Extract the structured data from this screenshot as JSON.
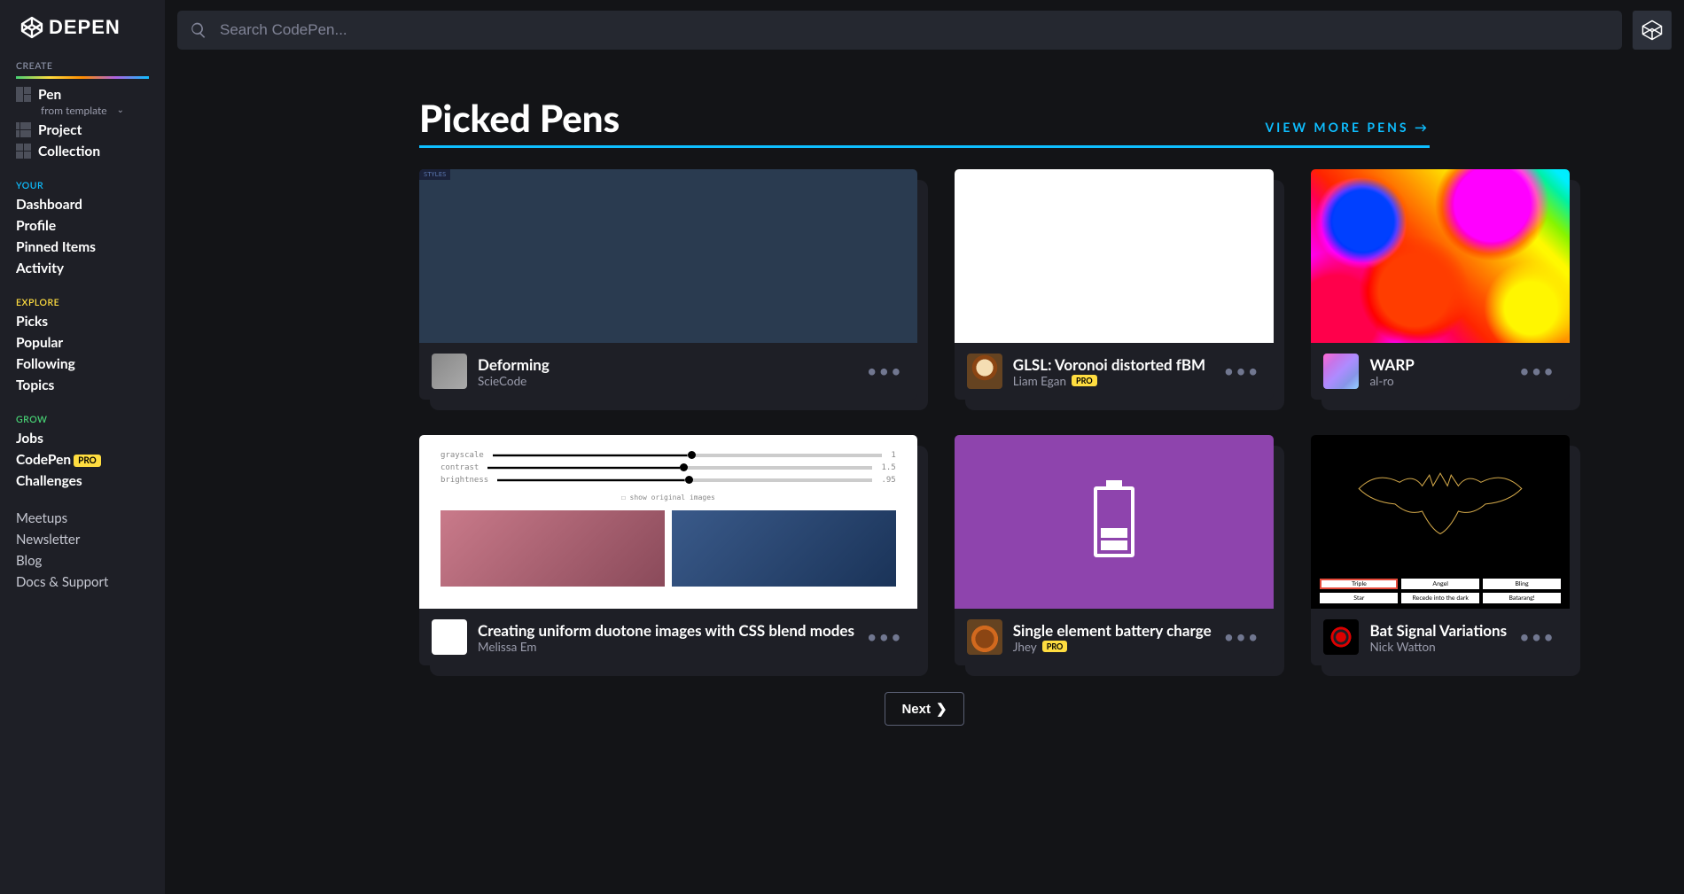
{
  "search": {
    "placeholder": "Search CodePen..."
  },
  "sidebar": {
    "labels": {
      "create": "CREATE",
      "your": "YOUR",
      "explore": "EXPLORE",
      "grow": "GROW"
    },
    "create": {
      "pen": "Pen",
      "from_template": "from template",
      "project": "Project",
      "collection": "Collection"
    },
    "your": [
      "Dashboard",
      "Profile",
      "Pinned Items",
      "Activity"
    ],
    "explore": [
      "Picks",
      "Popular",
      "Following",
      "Topics"
    ],
    "grow": {
      "jobs": "Jobs",
      "codepen": "CodePen",
      "pro": "PRO",
      "challenges": "Challenges"
    },
    "footer": [
      "Meetups",
      "Newsletter",
      "Blog",
      "Docs & Support"
    ]
  },
  "section": {
    "title": "Picked Pens",
    "view_more": "VIEW MORE PENS"
  },
  "pens": [
    {
      "title": "Deforming",
      "author": "ScieCode",
      "pro": false
    },
    {
      "title": "GLSL: Voronoi distorted fBM",
      "author": "Liam Egan",
      "pro": true
    },
    {
      "title": "WARP",
      "author": "al-ro",
      "pro": false
    },
    {
      "title": "Creating uniform duotone images with CSS blend modes",
      "author": "Melissa Em",
      "pro": false
    },
    {
      "title": "Single element battery charge",
      "author": "Jhey",
      "pro": true
    },
    {
      "title": "Bat Signal Variations",
      "author": "Nick Watton",
      "pro": false
    }
  ],
  "duotone": {
    "grayscale": "grayscale",
    "val1": "1",
    "contrast": "contrast",
    "val2": "1.5",
    "brightness": "brightness",
    "val3": ".95",
    "show": "☐ show original images"
  },
  "batman_buttons": [
    "Triple",
    "Angel",
    "Bling",
    "Star",
    "Recede into the dark",
    "Batarang!"
  ],
  "pager": {
    "next": "Next"
  },
  "pro_label": "PRO"
}
